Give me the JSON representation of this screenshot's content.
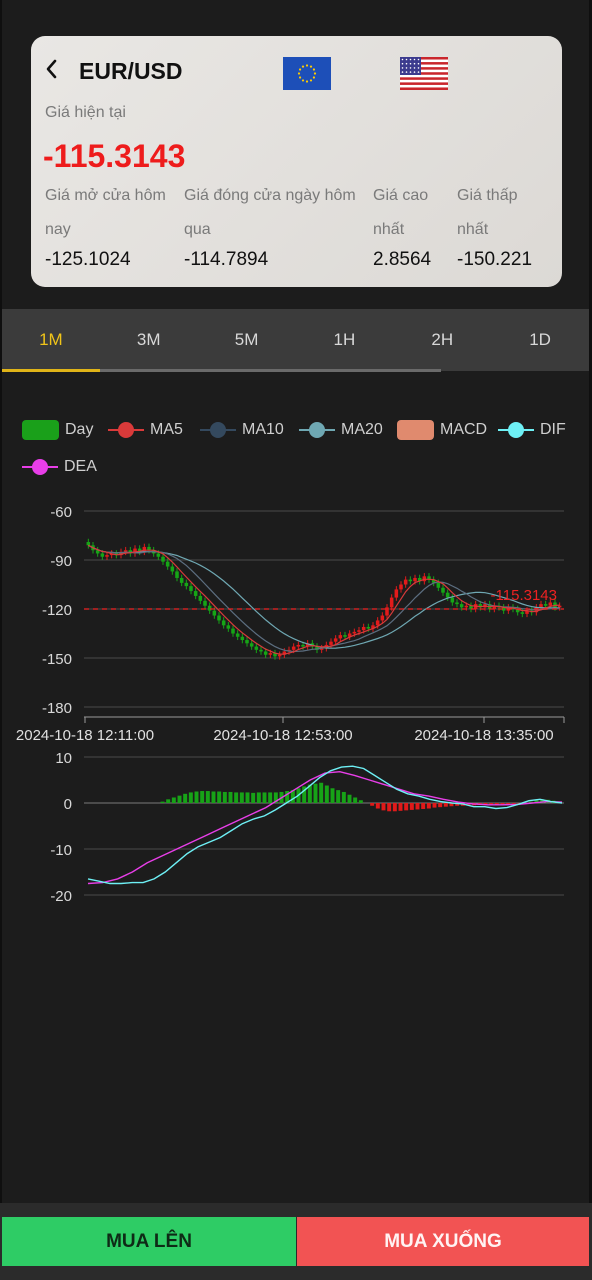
{
  "header": {
    "pair": "EUR/USD",
    "current_label": "Giá hiện tại",
    "current_price": "-115.3143",
    "stats": [
      {
        "label": "Giá mở cửa hôm nay",
        "value": "-125.1024"
      },
      {
        "label": "Giá đóng cửa ngày hôm qua",
        "value": "-114.7894"
      },
      {
        "label": "Giá cao nhất",
        "value": "2.8564"
      },
      {
        "label": "Giá thấp nhất",
        "value": "-150.221"
      }
    ]
  },
  "tabs": [
    "1M",
    "3M",
    "5M",
    "1H",
    "2H",
    "1D"
  ],
  "active_tab": "1M",
  "legend": [
    {
      "label": "Day",
      "color": "#1aa01a",
      "kind": "box"
    },
    {
      "label": "MA5",
      "color": "#d93a3a",
      "kind": "line"
    },
    {
      "label": "MA10",
      "color": "#34495e",
      "kind": "line"
    },
    {
      "label": "MA20",
      "color": "#6fa8b3",
      "kind": "line"
    },
    {
      "label": "MACD",
      "color": "#e08a6e",
      "kind": "box"
    },
    {
      "label": "DIF",
      "color": "#6ef0f5",
      "kind": "line"
    },
    {
      "label": "DEA",
      "color": "#e83ee8",
      "kind": "line"
    }
  ],
  "chart_data": [
    {
      "type": "candlestick",
      "y_ticks": [
        "-60",
        "-90",
        "-120",
        "-150",
        "-180"
      ],
      "ylim": [
        -180,
        -60
      ],
      "x_ticks": [
        "2024-10-18 12:11:00",
        "2024-10-18 12:53:00",
        "2024-10-18 13:35:00"
      ],
      "price_line": {
        "value": -120,
        "label": "-115.3143",
        "color": "#ee2222"
      },
      "series": [
        {
          "name": "Day",
          "closes": [
            -81,
            -84,
            -86,
            -88,
            -87,
            -86,
            -87,
            -85,
            -84,
            -86,
            -83,
            -85,
            -82,
            -84,
            -86,
            -88,
            -91,
            -94,
            -97,
            -101,
            -104,
            -106,
            -109,
            -112,
            -115,
            -118,
            -121,
            -124,
            -127,
            -130,
            -132,
            -135,
            -137,
            -139,
            -141,
            -143,
            -145,
            -146,
            -148,
            -147,
            -149,
            -148,
            -146,
            -145,
            -143,
            -142,
            -143,
            -141,
            -143,
            -145,
            -144,
            -142,
            -140,
            -138,
            -136,
            -137,
            -135,
            -134,
            -133,
            -131,
            -132,
            -130,
            -127,
            -124,
            -119,
            -113,
            -108,
            -105,
            -102,
            -103,
            -101,
            -103,
            -100,
            -102,
            -104,
            -107,
            -110,
            -113,
            -116,
            -117,
            -119,
            -118,
            -120,
            -117,
            -119,
            -117,
            -120,
            -118,
            -119,
            -121,
            -119,
            -120,
            -122,
            -123,
            -121,
            -122,
            -119,
            -117,
            -118,
            -116,
            -119,
            -118
          ]
        },
        {
          "name": "MA5"
        },
        {
          "name": "MA10"
        },
        {
          "name": "MA20"
        }
      ]
    },
    {
      "type": "macd",
      "y_ticks": [
        "10",
        "0",
        "-10",
        "-20"
      ],
      "ylim": [
        -20,
        10
      ],
      "series": [
        {
          "name": "MACD",
          "values": [
            0,
            0,
            0,
            0,
            0,
            0,
            0,
            0,
            0,
            0,
            0,
            0,
            0,
            0.3,
            0.8,
            1.2,
            1.6,
            2.0,
            2.3,
            2.5,
            2.6,
            2.6,
            2.5,
            2.5,
            2.4,
            2.4,
            2.3,
            2.3,
            2.3,
            2.2,
            2.3,
            2.3,
            2.3,
            2.3,
            2.4,
            2.6,
            2.8,
            3.2,
            3.6,
            4.0,
            4.2,
            4.4,
            3.8,
            3.2,
            2.8,
            2.4,
            1.8,
            1.2,
            0.6,
            0,
            -0.6,
            -1.2,
            -1.6,
            -1.8,
            -1.8,
            -1.7,
            -1.6,
            -1.5,
            -1.4,
            -1.3,
            -1.2,
            -1.0,
            -0.9,
            -0.8,
            -0.7,
            -0.6,
            -0.6,
            -0.5,
            -0.5,
            -0.4,
            -0.4,
            -0.3,
            -0.4,
            -0.3,
            -0.3,
            -0.2,
            -0.3,
            -0.2,
            0.3,
            0.6,
            0.8,
            0.7,
            0.5,
            0.3
          ]
        },
        {
          "name": "DIF",
          "values": [
            -16.5,
            -17,
            -17.5,
            -17.5,
            -17.3,
            -17.3,
            -16.5,
            -15,
            -13,
            -11,
            -9.5,
            -8.5,
            -7.5,
            -6,
            -4.5,
            -3.5,
            -2.8,
            -1.5,
            0,
            1.5,
            3.5,
            5.5,
            7,
            7.8,
            8.0,
            7.5,
            6,
            4.5,
            3,
            2,
            1.5,
            0.8,
            0.3,
            0,
            -0.2,
            -0.8,
            -0.8,
            -1.2,
            -1.0,
            -0.3,
            0.5,
            0.8,
            0.3,
            0
          ]
        },
        {
          "name": "DEA",
          "values": [
            -17.5,
            -17.3,
            -16.5,
            -15,
            -13,
            -11.5,
            -10,
            -8.5,
            -7,
            -5.5,
            -4,
            -2.5,
            -1,
            1,
            3,
            5,
            6.5,
            6.8,
            6,
            5,
            4,
            3,
            2,
            1.5,
            0.8,
            0.2,
            -0.2,
            -0.4,
            -0.4,
            -0.3,
            0,
            0.3,
            0.2
          ]
        }
      ]
    }
  ],
  "buttons": {
    "buy_up": "MUA LÊN",
    "buy_down": "MUA XUỐNG"
  }
}
